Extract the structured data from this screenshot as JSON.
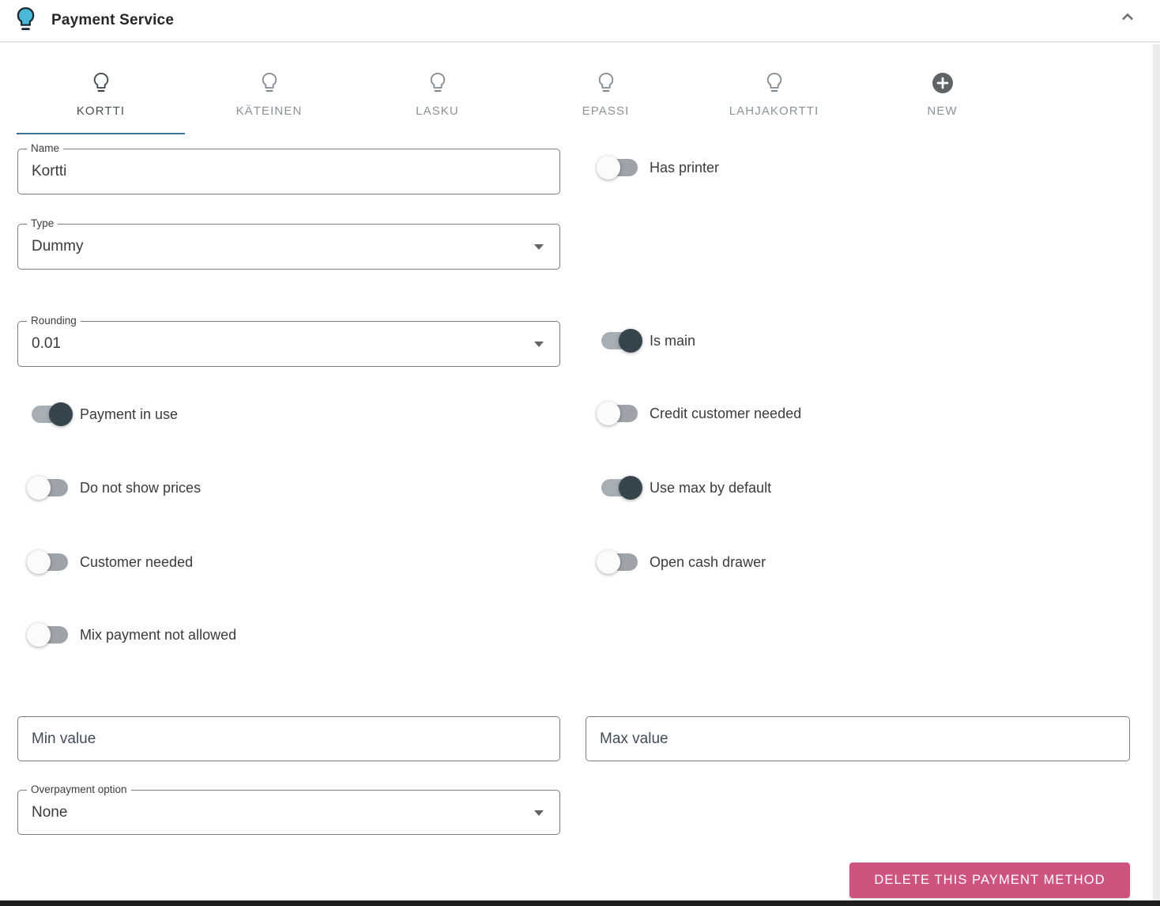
{
  "header": {
    "title": "Payment Service",
    "icon": "lightbulb-icon",
    "collapse_icon": "chevron-up-icon"
  },
  "tabs": [
    {
      "label": "KORTTI",
      "icon": "lightbulb-icon",
      "active": true
    },
    {
      "label": "KÄTEINEN",
      "icon": "lightbulb-icon",
      "active": false
    },
    {
      "label": "LASKU",
      "icon": "lightbulb-icon",
      "active": false
    },
    {
      "label": "EPASSI",
      "icon": "lightbulb-icon",
      "active": false
    },
    {
      "label": "LAHJAKORTTI",
      "icon": "lightbulb-icon",
      "active": false
    },
    {
      "label": "NEW",
      "icon": "plus-circle-icon",
      "active": false
    }
  ],
  "form": {
    "name": {
      "label": "Name",
      "value": "Kortti"
    },
    "type": {
      "label": "Type",
      "value": "Dummy"
    },
    "rounding": {
      "label": "Rounding",
      "value": "0.01"
    },
    "min_value": {
      "placeholder": "Min value",
      "value": ""
    },
    "max_value": {
      "placeholder": "Max value",
      "value": ""
    },
    "overpayment": {
      "label": "Overpayment option",
      "value": "None"
    },
    "toggles_left": [
      {
        "label": "Payment in use",
        "on": true
      },
      {
        "label": "Do not show prices",
        "on": false
      },
      {
        "label": "Customer needed",
        "on": false
      },
      {
        "label": "Mix payment not allowed",
        "on": false
      }
    ],
    "toggles_right": [
      {
        "label": "Has printer",
        "on": false
      },
      {
        "label": "Is main",
        "on": true
      },
      {
        "label": "Credit customer needed",
        "on": false
      },
      {
        "label": "Use max by default",
        "on": true
      },
      {
        "label": "Open cash drawer",
        "on": false
      }
    ]
  },
  "actions": {
    "delete_label": "DELETE THIS PAYMENT METHOD"
  },
  "colors": {
    "accent_teal": "#38758c",
    "toggle_on_thumb": "#36444d",
    "delete_pink": "#ce5480",
    "header_icon_blue": "#4ab9d8"
  }
}
